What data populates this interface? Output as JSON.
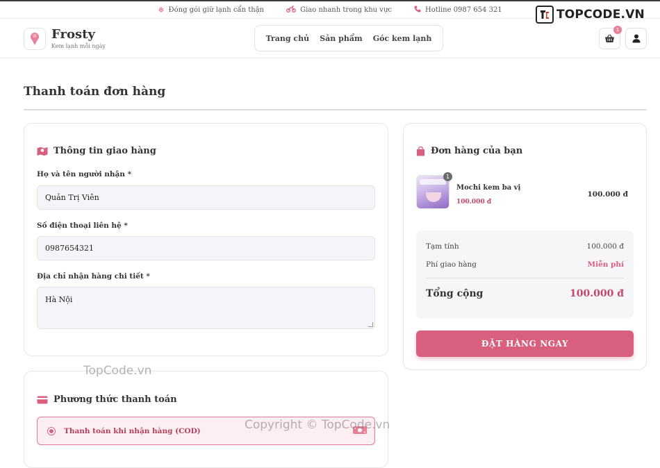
{
  "topbar": {
    "items": [
      {
        "icon": "snowflake-icon",
        "text": "Đóng gói giữ lạnh cẩn thận"
      },
      {
        "icon": "motorbike-icon",
        "text": "Giao nhanh trong khu vực"
      },
      {
        "icon": "phone-icon",
        "text": "Hotline 0987 654 321"
      }
    ]
  },
  "watermark": {
    "logo_text": "TOPCODE.VN",
    "center_text": "TopCode.vn",
    "copyright": "Copyright © TopCode.vn"
  },
  "brand": {
    "name": "Frosty",
    "tagline": "Kem lạnh mỗi ngày"
  },
  "nav": {
    "items": [
      "Trang chủ",
      "Sản phẩm",
      "Góc kem lạnh"
    ]
  },
  "cart": {
    "count": "1"
  },
  "page": {
    "title": "Thanh toán đơn hàng"
  },
  "shipping": {
    "title": "Thông tin giao hàng",
    "name_label": "Họ và tên người nhận *",
    "name_value": "Quản Trị Viên",
    "phone_label": "Số điện thoại liên hệ *",
    "phone_value": "0987654321",
    "address_label": "Địa chỉ nhận hàng chi tiết *",
    "address_value": "Hà Nội"
  },
  "payment": {
    "title": "Phương thức thanh toán",
    "option_cod": "Thanh toán khi nhận hàng (COD)"
  },
  "order": {
    "title": "Đơn hàng của bạn",
    "item": {
      "name": "Mochi kem ba vị",
      "unit_price": "100.000 đ",
      "line_total": "100.000 đ",
      "quantity": "1"
    },
    "subtotal_label": "Tạm tính",
    "subtotal_value": "100.000 đ",
    "shipping_label": "Phí giao hàng",
    "shipping_value": "Miễn phí",
    "total_label": "Tổng cộng",
    "total_value": "100.000 đ",
    "button_label": "ĐẶT HÀNG NGAY"
  },
  "colors": {
    "accent": "#d95f7e",
    "accent_light": "#fdeef2",
    "field_bg": "#f5f5f9"
  }
}
